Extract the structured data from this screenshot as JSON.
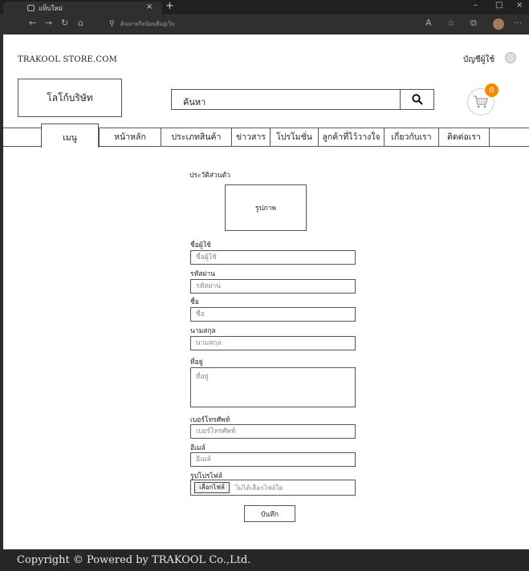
{
  "browser": {
    "tab_title": "แท็บใหม่",
    "tab_close": "×",
    "new_tab": "+",
    "address_text": "ค้นหาหรือป้อนที่อยู่เว็บ",
    "window_controls": {
      "minimize": "–",
      "maximize": "□",
      "close": "×"
    },
    "toolbar_icons": [
      "back-icon",
      "forward-icon",
      "refresh-icon",
      "home-icon",
      "search-icon",
      "read-aloud-icon",
      "favorites-icon",
      "collections-icon",
      "profile-icon",
      "more-icon"
    ]
  },
  "header": {
    "site_name": "TRAKOOL STORE.COM",
    "account": "บัญชีผู้ใช้",
    "logo": "โลโก้บริษัท",
    "search_label": "ค้นหา",
    "cart_count": "0"
  },
  "nav": {
    "items": [
      {
        "label": "เมนู"
      },
      {
        "label": "หน้าหลัก"
      },
      {
        "label": "ประเภทสินค้า"
      },
      {
        "label": "ข่าวสาร"
      },
      {
        "label": "โปรโมชั่น"
      },
      {
        "label": "ลูกค้าที่ไว้วางใจ"
      },
      {
        "label": "เกี่ยวกับเรา"
      },
      {
        "label": "ติดต่อเรา"
      }
    ]
  },
  "profile_form": {
    "section_title": "ประวัติส่วนตัว",
    "photo_label": "รูปภาพ",
    "fields": [
      {
        "label": "ชื่อผู้ใช้",
        "placeholder": "ชื่อผู้ใช้"
      },
      {
        "label": "รหัสผ่าน",
        "placeholder": "รหัสผ่าน"
      },
      {
        "label": "ชื่อ",
        "placeholder": "ชื่อ"
      },
      {
        "label": "นามสกุล",
        "placeholder": "นามสกุล"
      },
      {
        "label": "ที่อยู่",
        "placeholder": "ที่อยู่"
      },
      {
        "label": "เบอร์โทรศัพท์",
        "placeholder": "เบอร์โทรศัพท์"
      },
      {
        "label": "อีเมล์",
        "placeholder": "อีเมล์"
      }
    ],
    "profile_pic_label": "รูปโปรไฟล์",
    "file_button": "เลือกไฟล์",
    "file_status": "ไม่ได้เลือกไฟล์ใด",
    "save_button": "บันทึก"
  },
  "footer": {
    "copyright": "Copyright © Powered by TRAKOOL Co.,Ltd."
  },
  "colors": {
    "cart_badge": "#f08c00",
    "chrome_dark": "#202020",
    "footer_bg": "#262626"
  }
}
